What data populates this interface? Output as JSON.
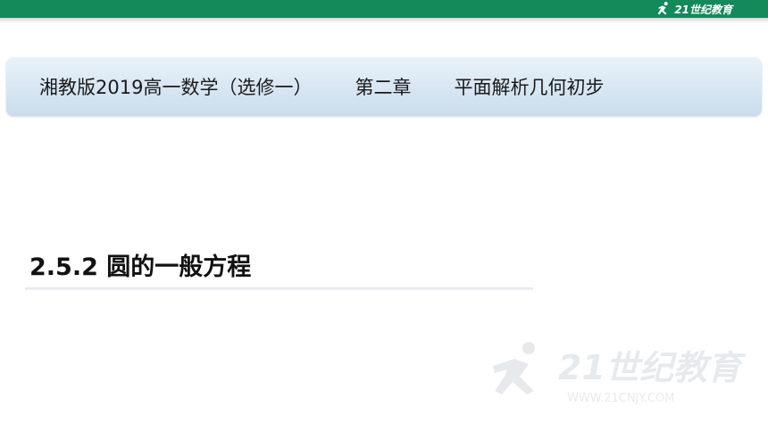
{
  "brand": {
    "logo_text": "21世纪教育",
    "watermark_text": "21世纪教育",
    "watermark_url": "WWW.21CNJY.COM"
  },
  "header": {
    "course": "湘教版2019高一数学（选修一）",
    "chapter": "第二章",
    "topic": "平面解析几何初步"
  },
  "lesson": {
    "title": "2.5.2 圆的一般方程"
  },
  "colors": {
    "top_bar": "#148a5a",
    "header_band": "#d6e5f1",
    "title_text": "#111111"
  }
}
